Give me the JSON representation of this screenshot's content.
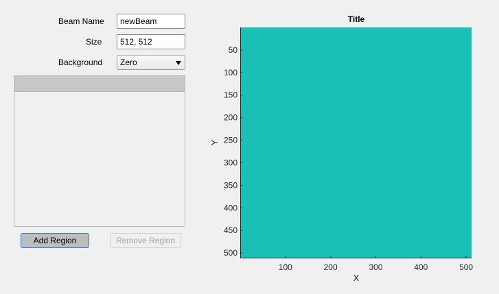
{
  "form": {
    "beam_name_label": "Beam Name",
    "beam_name_value": "newBeam",
    "size_label": "Size",
    "size_value": "512, 512",
    "background_label": "Background",
    "background_value": "Zero"
  },
  "buttons": {
    "add_region": "Add Region",
    "remove_region": "Remove Region"
  },
  "colors": {
    "image_fill": "#1abfb6",
    "window_bg": "#f0f0f0"
  },
  "chart_data": {
    "type": "heatmap",
    "title": "Title",
    "xlabel": "X",
    "ylabel": "Y",
    "xlim": [
      0,
      512
    ],
    "ylim": [
      0,
      512
    ],
    "y_reversed": true,
    "x_ticks": [
      100,
      200,
      300,
      400,
      500
    ],
    "y_ticks": [
      50,
      100,
      150,
      200,
      250,
      300,
      350,
      400,
      450,
      500
    ],
    "grid": false,
    "values": "uniform zero background (single color)"
  }
}
